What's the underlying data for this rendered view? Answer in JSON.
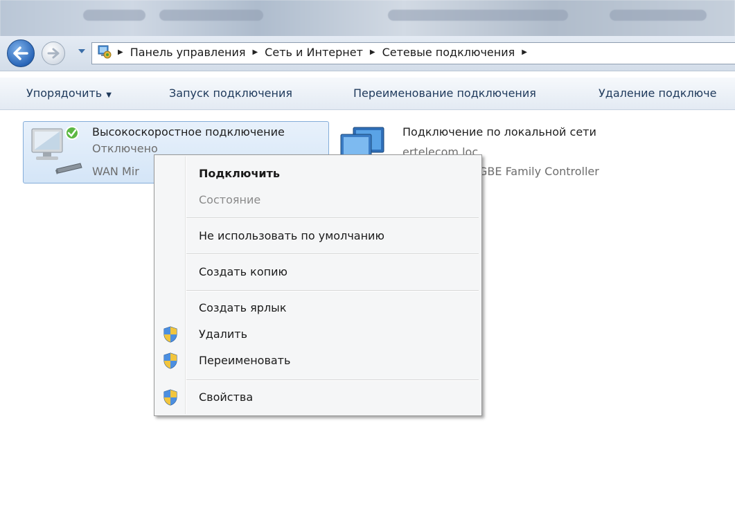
{
  "address_bar": {
    "crumbs": [
      "Панель управления",
      "Сеть и Интернет",
      "Сетевые подключения"
    ]
  },
  "toolbar": {
    "organize": "Упорядочить",
    "start_connection": "Запуск подключения",
    "rename_connection": "Переименование подключения",
    "delete_connection": "Удаление подключе"
  },
  "connections": [
    {
      "name": "Высокоскоростное подключение",
      "status": "Отключено",
      "device": "WAN Mir"
    },
    {
      "name": "Подключение по локальной сети",
      "status": "ertelecom.loc",
      "device": "GBE Family Controller"
    }
  ],
  "context_menu": {
    "items": [
      {
        "label": "Подключить",
        "bold": true
      },
      {
        "label": "Состояние",
        "disabled": true
      },
      {
        "label": "Не использовать по умолчанию"
      },
      {
        "label": "Создать копию"
      },
      {
        "label": "Создать ярлык"
      },
      {
        "label": "Удалить",
        "icon": "uac-shield-icon"
      },
      {
        "label": "Переименовать",
        "icon": "uac-shield-icon"
      },
      {
        "label": "Свойства",
        "icon": "uac-shield-icon"
      }
    ]
  },
  "colors": {
    "selection": "#d4e5f7",
    "toolbar_text": "#1e395b",
    "menu_bg": "#f5f6f7"
  }
}
